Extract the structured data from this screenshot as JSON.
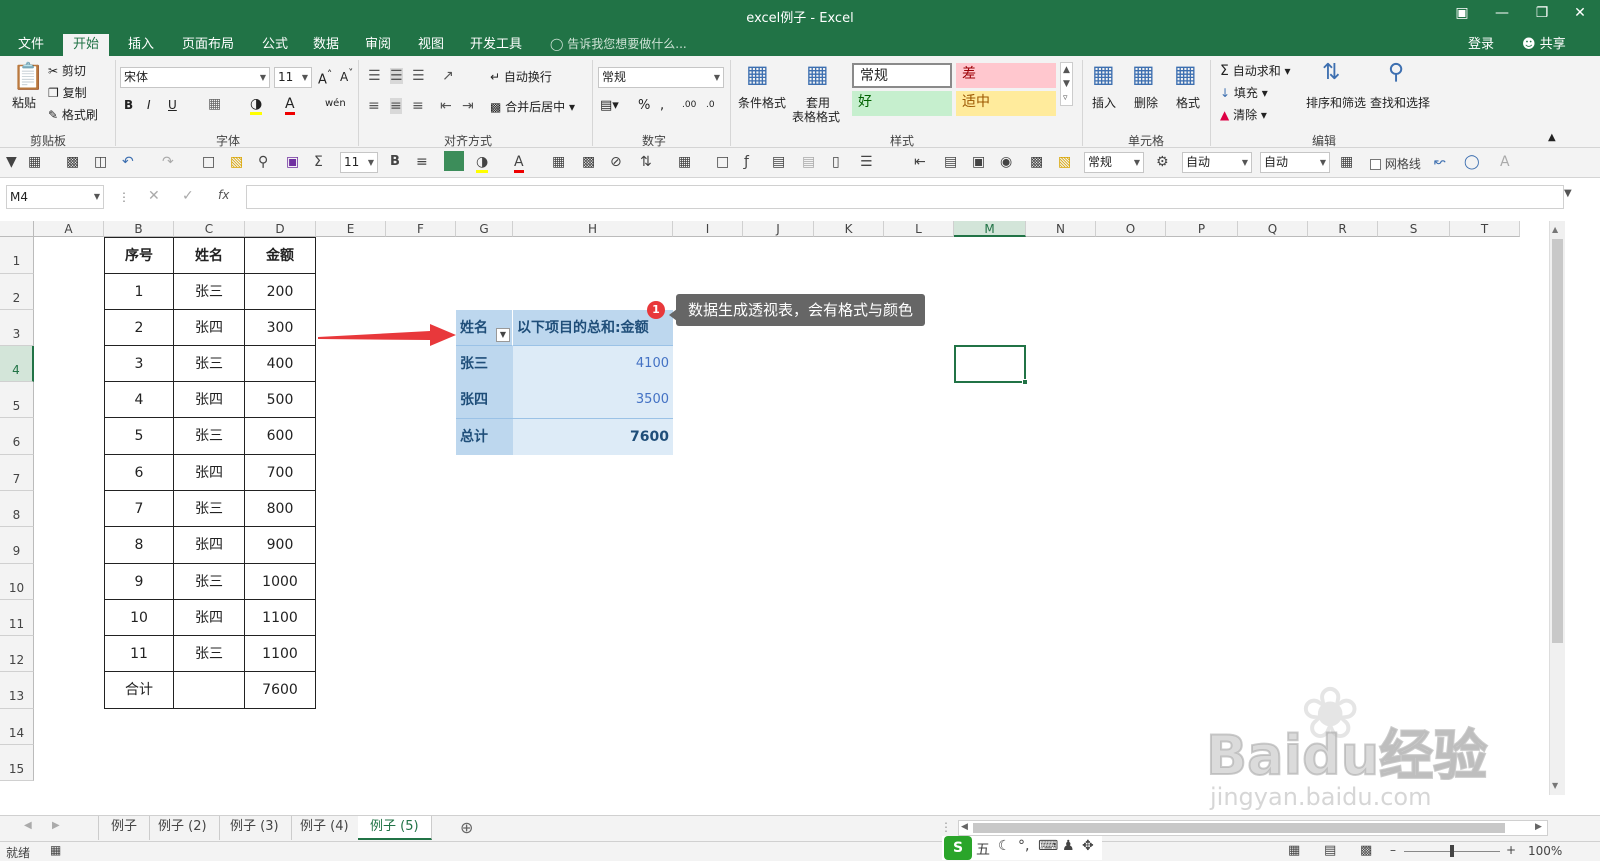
{
  "window": {
    "title": "excel例子 - Excel"
  },
  "ribbon_tabs": [
    "文件",
    "开始",
    "插入",
    "页面布局",
    "公式",
    "数据",
    "审阅",
    "视图",
    "开发工具"
  ],
  "tell_me": "告诉我您想要做什么...",
  "account": {
    "login": "登录",
    "share": "共享"
  },
  "clipboard": {
    "paste": "粘贴",
    "cut": "剪切",
    "copy": "复制",
    "format_painter": "格式刷",
    "label": "剪贴板"
  },
  "font": {
    "name": "宋体",
    "size": "11",
    "label": "字体"
  },
  "alignment": {
    "wrap": "自动换行",
    "merge": "合并后居中",
    "label": "对齐方式"
  },
  "number": {
    "format": "常规",
    "label": "数字"
  },
  "styles": {
    "conditional": "条件格式",
    "table_line1": "套用",
    "table_line2": "表格格式",
    "normal": "常规",
    "bad": "差",
    "good": "好",
    "neutral": "适中",
    "label": "样式"
  },
  "cells": {
    "insert": "插入",
    "delete": "删除",
    "format": "格式",
    "label": "单元格"
  },
  "editing": {
    "autosum": "自动求和",
    "fill": "填充",
    "clear": "清除",
    "sort": "排序和筛选",
    "find": "查找和选择",
    "label": "编辑"
  },
  "qat": {
    "size": "11",
    "format": "常规",
    "auto1": "自动",
    "auto2": "自动",
    "gridlines": "网格线"
  },
  "formula_bar": {
    "name_box": "M4",
    "fx": "fx",
    "content": ""
  },
  "columns": [
    "A",
    "B",
    "C",
    "D",
    "E",
    "F",
    "G",
    "H",
    "I",
    "J",
    "K",
    "L",
    "M",
    "N",
    "O",
    "P",
    "Q",
    "R",
    "S",
    "T"
  ],
  "rows": [
    "1",
    "2",
    "3",
    "4",
    "5",
    "6",
    "7",
    "8",
    "9",
    "10",
    "11",
    "12",
    "13",
    "14",
    "15"
  ],
  "table": {
    "headers": [
      "序号",
      "姓名",
      "金额"
    ],
    "rows": [
      [
        "1",
        "张三",
        "200"
      ],
      [
        "2",
        "张四",
        "300"
      ],
      [
        "3",
        "张三",
        "400"
      ],
      [
        "4",
        "张四",
        "500"
      ],
      [
        "5",
        "张三",
        "600"
      ],
      [
        "6",
        "张四",
        "700"
      ],
      [
        "7",
        "张三",
        "800"
      ],
      [
        "8",
        "张四",
        "900"
      ],
      [
        "9",
        "张三",
        "1000"
      ],
      [
        "10",
        "张四",
        "1100"
      ],
      [
        "11",
        "张三",
        "1100"
      ],
      [
        "合计",
        "",
        "7600"
      ]
    ]
  },
  "pivot": {
    "header_name": "姓名",
    "header_value": "以下项目的总和:金额",
    "rows": [
      [
        "张三",
        "4100"
      ],
      [
        "张四",
        "3500"
      ],
      [
        "总计",
        "7600"
      ]
    ]
  },
  "annotation": {
    "badge": "1",
    "text": "数据生成透视表，会有格式与颜色"
  },
  "sheet_tabs": [
    "例子",
    "例子 (2)",
    "例子 (3)",
    "例子 (4)",
    "例子 (5)"
  ],
  "active_sheet": "例子 (5)",
  "status": {
    "ready": "就绪",
    "zoom": "100%"
  },
  "ime": {
    "label": "五"
  },
  "watermark": {
    "brand": "Baidu经验",
    "url": "jingyan.baidu.com"
  },
  "colors": {
    "excel_green": "#217346",
    "pivot_header": "#bdd7ee",
    "pivot_body": "#ddebf7",
    "pivot_text": "#1f4e79",
    "tooltip": "#666666",
    "arrow": "#e8383b"
  }
}
